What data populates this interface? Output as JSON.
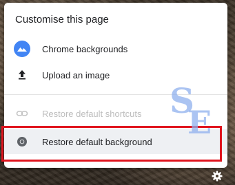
{
  "menu": {
    "title": "Customise this page",
    "items": [
      {
        "label": "Chrome backgrounds",
        "icon": "chrome-backgrounds-icon",
        "enabled": true
      },
      {
        "label": "Upload an image",
        "icon": "upload-icon",
        "enabled": true
      },
      {
        "label": "Restore default shortcuts",
        "icon": "link-icon",
        "enabled": false
      },
      {
        "label": "Restore default background",
        "icon": "chrome-logo-icon",
        "enabled": true,
        "hovered": true
      }
    ]
  },
  "watermark": "SE",
  "colors": {
    "accent_blue": "#4285f4",
    "highlight_red": "#e0141e",
    "hover_bg": "#eef0f3",
    "disabled_text": "#bdbdbd"
  },
  "footer": {
    "settings_icon": "gear-icon"
  }
}
